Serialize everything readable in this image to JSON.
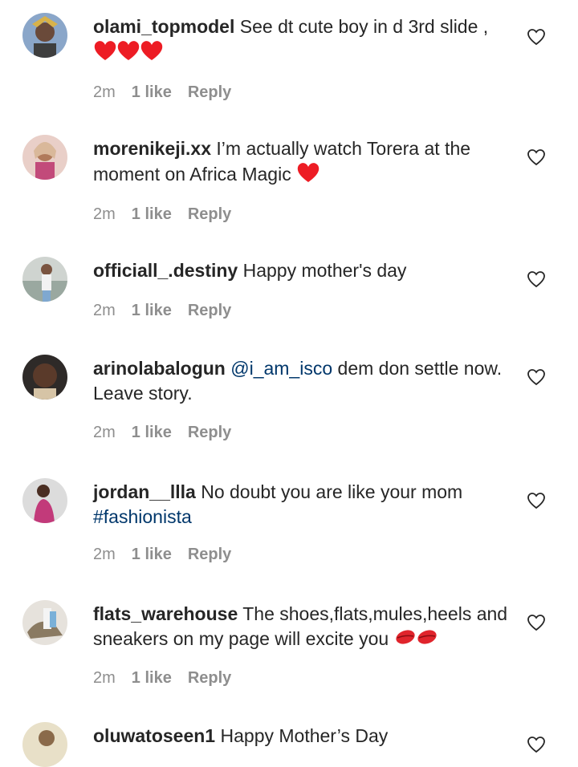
{
  "comments": [
    {
      "username": "olami_topmodel",
      "text": "See dt cute boy in d 3rd slide ,",
      "time": "2m",
      "likes": "1 like",
      "reply": "Reply",
      "emoji": "❤❤❤"
    },
    {
      "username": "morenikeji.xx",
      "text": "I’m actually watch Torera at the moment on Africa Magic",
      "time": "2m",
      "likes": "1 like",
      "reply": "Reply",
      "emoji": "❤"
    },
    {
      "username": "officiall_.destiny",
      "text": "Happy mother's day",
      "time": "2m",
      "likes": "1 like",
      "reply": "Reply"
    },
    {
      "username": "arinolabalogun",
      "mention": "@i_am_isco",
      "text": "dem don settle now. Leave story.",
      "time": "2m",
      "likes": "1 like",
      "reply": "Reply"
    },
    {
      "username": "jordan__llla",
      "text": "No doubt you are like your mom",
      "hashtag": "#fashionista",
      "time": "2m",
      "likes": "1 like",
      "reply": "Reply"
    },
    {
      "username": "flats_warehouse",
      "text": "The shoes,flats,mules,heels and sneakers on my page will excite you",
      "time": "2m",
      "likes": "1 like",
      "reply": "Reply",
      "emoji": "💋💋"
    },
    {
      "username": "oluwatoseen1",
      "text": "Happy Mother’s Day"
    }
  ],
  "colors": {
    "text": "#262626",
    "muted": "#8e8e8e",
    "link": "#00376b",
    "heart_red": "#ed1c24"
  }
}
